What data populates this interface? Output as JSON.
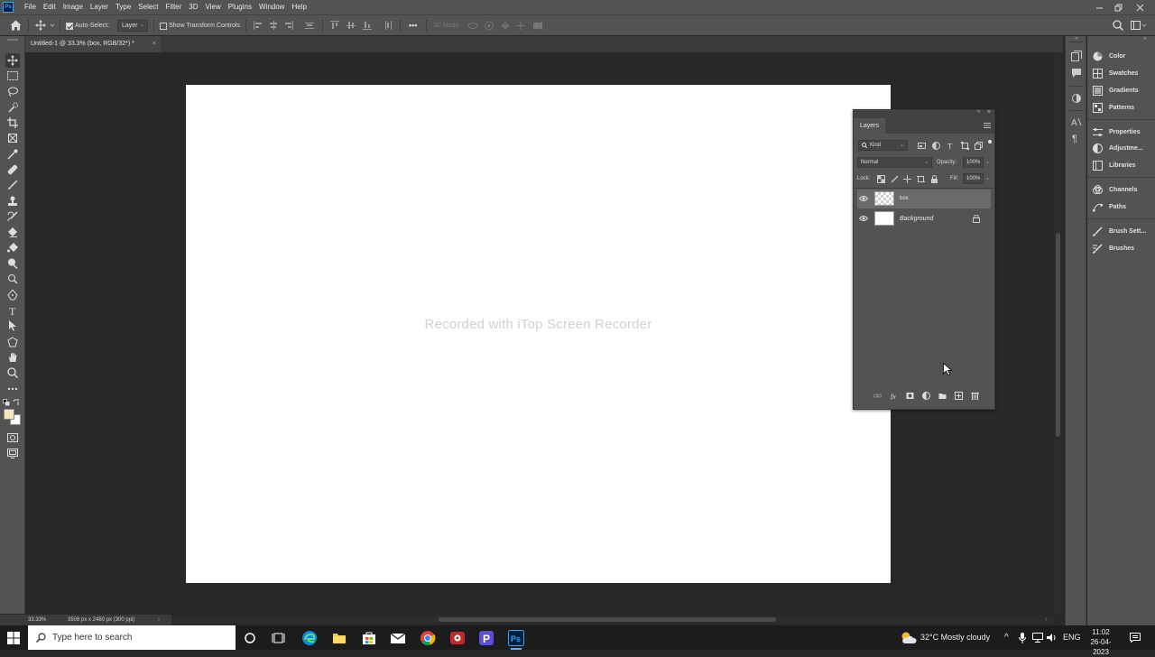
{
  "menubar": {
    "logo": "Ps",
    "items": [
      "File",
      "Edit",
      "Image",
      "Layer",
      "Type",
      "Select",
      "Filter",
      "3D",
      "View",
      "Plugins",
      "Window",
      "Help"
    ]
  },
  "options": {
    "auto_select_label": "Auto-Select:",
    "auto_select_checked": true,
    "auto_select_target": "Layer",
    "show_transform_label": "Show Transform Controls",
    "mode_3d_label": "3D Mode:",
    "more_label": "•••"
  },
  "document_tab": {
    "title": "Untitled-1 @ 33.3% (box, RGB/32*) *",
    "close": "×"
  },
  "canvas": {
    "watermark": "Recorded with iTop Screen Recorder",
    "background_color": "#ffffff"
  },
  "statusbar": {
    "zoom": "33.33%",
    "doc_info": "3508 px x 2480 px (300 ppi)",
    "arrow": "›"
  },
  "right_panels": [
    {
      "label": "Color",
      "icon": "color-wheel-icon"
    },
    {
      "label": "Swatches",
      "icon": "swatches-grid-icon"
    },
    {
      "label": "Gradients",
      "icon": "gradients-icon"
    },
    {
      "label": "Patterns",
      "icon": "patterns-icon"
    },
    {
      "label": "Properties",
      "icon": "properties-icon"
    },
    {
      "label": "Adjustme...",
      "icon": "adjustments-icon"
    },
    {
      "label": "Libraries",
      "icon": "libraries-icon"
    },
    {
      "label": "Channels",
      "icon": "channels-icon"
    },
    {
      "label": "Paths",
      "icon": "paths-icon"
    },
    {
      "label": "Brush Sett...",
      "icon": "brush-settings-icon"
    },
    {
      "label": "Brushes",
      "icon": "brushes-icon"
    }
  ],
  "layers_panel": {
    "tab_label": "Layers",
    "filter_kind": "Kind",
    "blend_mode": "Normal",
    "opacity_label": "Opacity:",
    "opacity_value": "100%",
    "lock_label": "Lock:",
    "fill_label": "Fill:",
    "fill_value": "100%",
    "layers": [
      {
        "name": "box",
        "selected": true,
        "visible": true,
        "thumb": "transparent"
      },
      {
        "name": "Background",
        "selected": false,
        "visible": true,
        "thumb": "white",
        "locked": true
      }
    ]
  },
  "taskbar": {
    "search_placeholder": "Type here to search",
    "weather": "32°C  Mostly cloudy",
    "language": "ENG",
    "time": "11:02",
    "date": "26-04-2023"
  },
  "colors": {
    "ui_panel": "#535353",
    "ui_dark": "#282828",
    "foreground_swatch": "#f5e6c0",
    "background_swatch": "#ffffff",
    "ps_accent": "#31a8ff"
  }
}
